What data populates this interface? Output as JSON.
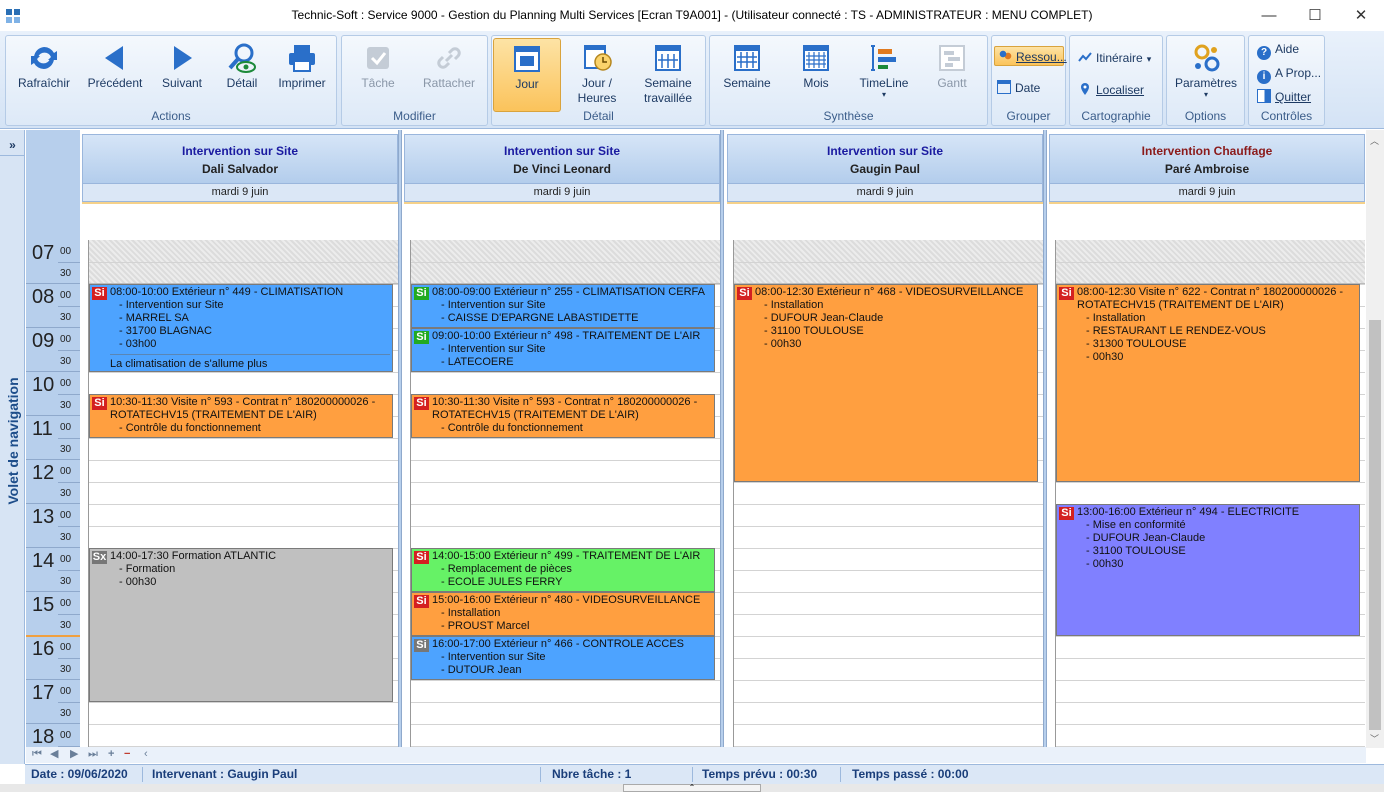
{
  "window": {
    "title": "Technic-Soft : Service 9000 - Gestion du Planning Multi Services [Ecran T9A001] - (Utilisateur connecté : TS  - ADMINISTRATEUR : MENU COMPLET)",
    "minimize": "—",
    "maximize": "☐",
    "close": "✕"
  },
  "ribbon": {
    "actions": {
      "label": "Actions",
      "refresh": "Rafraîchir",
      "previous": "Précédent",
      "next": "Suivant",
      "detail": "Détail",
      "print": "Imprimer"
    },
    "modifier": {
      "label": "Modifier",
      "task": "Tâche",
      "attach": "Rattacher"
    },
    "detail": {
      "label": "Détail",
      "day": "Jour",
      "day_hours_1": "Jour /",
      "day_hours_2": "Heures",
      "work_week_1": "Semaine",
      "work_week_2": "travaillée"
    },
    "synthese": {
      "label": "Synthèse",
      "week": "Semaine",
      "month": "Mois",
      "timeline": "TimeLine",
      "gantt": "Gantt"
    },
    "grouper": {
      "label": "Grouper",
      "resources": "Ressou...",
      "date": "Date"
    },
    "cartographie": {
      "label": "Cartographie",
      "itinerary": "Itinéraire",
      "locate": "Localiser"
    },
    "options": {
      "label": "Options",
      "params": "Paramètres"
    },
    "controles": {
      "label": "Contrôles",
      "help": "Aide",
      "about": "A Prop...",
      "quit": "Quitter"
    }
  },
  "nav_pane": {
    "expand": "»",
    "label": "Volet de navigation"
  },
  "hours": [
    "07",
    "08",
    "09",
    "10",
    "11",
    "12",
    "13",
    "14",
    "15",
    "16",
    "17",
    "18"
  ],
  "minutes": {
    "top": "00",
    "half": "30"
  },
  "columns": [
    {
      "title": "Intervention sur Site",
      "name": "Dali Salvador",
      "date": "mardi 9 juin",
      "title_color": "blue"
    },
    {
      "title": "Intervention sur Site",
      "name": "De Vinci Leonard",
      "date": "mardi 9 juin",
      "title_color": "blue"
    },
    {
      "title": "Intervention sur Site",
      "name": "Gaugin Paul",
      "date": "mardi 9 juin",
      "title_color": "blue"
    },
    {
      "title": "Intervention Chauffage",
      "name": "Paré Ambroise",
      "date": "mardi 9 juin",
      "title_color": "red"
    }
  ],
  "events": {
    "c1e1": {
      "badge": "Si",
      "color": "#4da3ff",
      "l1": "08:00-10:00 Extérieur n° 449 - CLIMATISATION",
      "l2": "- Intervention sur Site",
      "l3": "- MARREL SA",
      "l4": "- 31700 BLAGNAC",
      "l5": "- 03h00",
      "note": "La climatisation de s'allume plus"
    },
    "c1e2": {
      "badge": "Si",
      "color": "#ff9f40",
      "l1": "10:30-11:30 Visite n° 593 - Contrat n° 180200000026 -",
      "l2": "ROTATECHV15 (TRAITEMENT DE L'AIR)",
      "l3": "- Contrôle du fonctionnement"
    },
    "c1e3": {
      "badge": "Sx",
      "color": "#c0c0c0",
      "l1": "14:00-17:30 Formation ATLANTIC",
      "l2": "- Formation",
      "l3": "- 00h30"
    },
    "c2e1": {
      "badge": "Si",
      "color": "#4da3ff",
      "l1": "08:00-09:00 Extérieur n° 255 - CLIMATISATION CERFA",
      "l2": "- Intervention sur Site",
      "l3": "- CAISSE D'EPARGNE LABASTIDETTE"
    },
    "c2e2": {
      "badge": "Si",
      "color": "#4da3ff",
      "l1": "09:00-10:00 Extérieur n° 498 - TRAITEMENT DE L'AIR",
      "l2": "- Intervention sur Site",
      "l3": "- LATECOERE"
    },
    "c2e3": {
      "badge": "Si",
      "color": "#ff9f40",
      "l1": "10:30-11:30 Visite n° 593 - Contrat n° 180200000026 -",
      "l2": "ROTATECHV15 (TRAITEMENT DE L'AIR)",
      "l3": "- Contrôle du fonctionnement"
    },
    "c2e4": {
      "badge": "Si",
      "color": "#66f266",
      "l1": "14:00-15:00 Extérieur n° 499 - TRAITEMENT DE L'AIR",
      "l2": "- Remplacement de pièces",
      "l3": "- ECOLE JULES FERRY"
    },
    "c2e5": {
      "badge": "Si",
      "color": "#ff9f40",
      "l1": "15:00-16:00 Extérieur n° 480 - VIDEOSURVEILLANCE",
      "l2": "- Installation",
      "l3": "- PROUST Marcel"
    },
    "c2e6": {
      "badge": "Si",
      "color": "#4da3ff",
      "l1": "16:00-17:00 Extérieur n° 466 - CONTROLE ACCES",
      "l2": "- Intervention sur Site",
      "l3": "- DUTOUR Jean"
    },
    "c3e1": {
      "badge": "Si",
      "color": "#ff9f40",
      "l1": "08:00-12:30 Extérieur n° 468 - VIDEOSURVEILLANCE",
      "l2": "- Installation",
      "l3": "- DUFOUR Jean-Claude",
      "l4": "- 31100 TOULOUSE",
      "l5": "- 00h30"
    },
    "c4e1": {
      "badge": "Si",
      "color": "#ff9f40",
      "l1": "08:00-12:30 Visite n° 622 - Contrat n° 180200000026 -",
      "l2": "ROTATECHV15 (TRAITEMENT DE L'AIR)",
      "l3": "- Installation",
      "l4": "- RESTAURANT LE RENDEZ-VOUS",
      "l5": "- 31300 TOULOUSE",
      "l6": "- 00h30"
    },
    "c4e2": {
      "badge": "Si",
      "color": "#8080ff",
      "l1": "13:00-16:00 Extérieur n° 494 - ELECTRICITE",
      "l2": "- Mise en conformité",
      "l3": "- DUFOUR Jean-Claude",
      "l4": "- 31100 TOULOUSE",
      "l5": "- 00h30"
    }
  },
  "navbar": {
    "first": "⏮",
    "prev": "◀",
    "next": "▶",
    "last": "⏭",
    "add": "+",
    "remove": "−",
    "scroll_left": "‹"
  },
  "status": {
    "date": "Date : 09/06/2020",
    "intervenant": "Intervenant : Gaugin Paul",
    "tasks": "Nbre tâche : 1",
    "planned": "Temps prévu : 00:30",
    "spent": "Temps passé : 00:00"
  },
  "colors": {
    "accent": "#1d4d8a",
    "ribbon_active": "#fbc35b",
    "badge_red": "#d42020",
    "badge_green": "#22aa22",
    "badge_gray": "#777777"
  }
}
